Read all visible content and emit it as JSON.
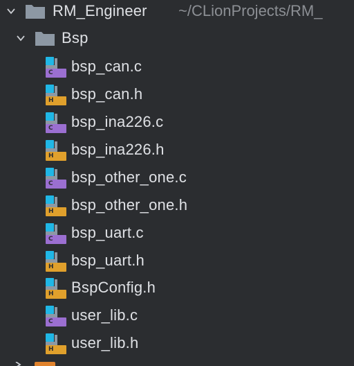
{
  "project": {
    "name": "RM_Engineer",
    "path": "~/CLionProjects/RM_"
  },
  "folder": {
    "name": "Bsp"
  },
  "files": [
    {
      "name": "bsp_can.c",
      "type": "C"
    },
    {
      "name": "bsp_can.h",
      "type": "H"
    },
    {
      "name": "bsp_ina226.c",
      "type": "C"
    },
    {
      "name": "bsp_ina226.h",
      "type": "H"
    },
    {
      "name": "bsp_other_one.c",
      "type": "C"
    },
    {
      "name": "bsp_other_one.h",
      "type": "H"
    },
    {
      "name": "bsp_uart.c",
      "type": "C"
    },
    {
      "name": "bsp_uart.h",
      "type": "H"
    },
    {
      "name": "BspConfig.h",
      "type": "H"
    },
    {
      "name": "user_lib.c",
      "type": "C"
    },
    {
      "name": "user_lib.h",
      "type": "H"
    }
  ],
  "colors": {
    "background": "#2b2d30",
    "c_badge": "#9b6fd1",
    "h_badge": "#e0a02c",
    "file_blue": "#20b7e6",
    "folder_grey": "#8d98a4"
  }
}
